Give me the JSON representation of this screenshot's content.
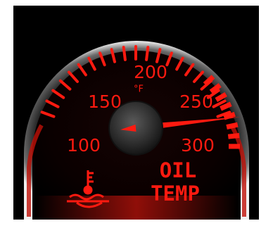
{
  "gauge": {
    "title_line1": "OIL",
    "title_line2": "TEMP",
    "unit": "°F",
    "scale": [
      {
        "label": "100",
        "value": 100
      },
      {
        "label": "150",
        "value": 150
      },
      {
        "label": "200",
        "value": 200
      },
      {
        "label": "250",
        "value": 250
      },
      {
        "label": "300",
        "value": 300
      }
    ],
    "min": 100,
    "max": 300,
    "reading": 275,
    "icon": "oil-temperature-icon",
    "colors": {
      "background": "#000000",
      "accent": "#ff1a10",
      "bezel": "#d8d8d8",
      "hub": "#3a3a3a"
    }
  }
}
